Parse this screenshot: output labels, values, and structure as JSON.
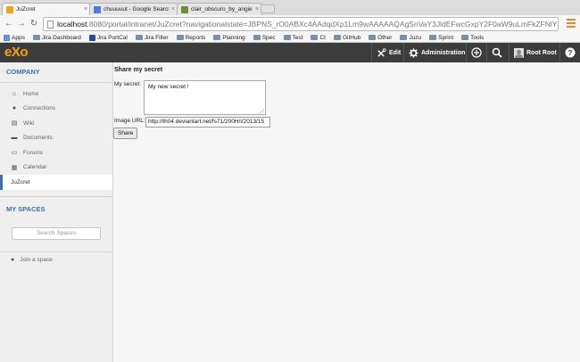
{
  "browser": {
    "tabs": [
      {
        "title": "JuZcret",
        "active": true,
        "favicon_color": "#f7a21b"
      },
      {
        "title": "chuuuuut - Google Search",
        "active": false,
        "favicon_color": "#4a7be0"
      },
      {
        "title": "clair_obscuro_by_angiecal",
        "active": false,
        "favicon_color": "#6a8f3a"
      }
    ],
    "url_host": "localhost",
    "url_rest": ":8080/portal/intranet/JuZcret?navigationalstate=JBPNS_rO0ABXc4AAdqdXp1Lm9wAAAAAQAgSnVaY3JldEFwcGxpY2F0aW9uLmFkZFNlY3JldEZvcm0AB1...",
    "bookmarks": [
      {
        "label": "Apps",
        "icon": "apps-grid-icon"
      },
      {
        "label": "Jira Dashboard",
        "icon": "folder-icon"
      },
      {
        "label": "Jira PortCal",
        "icon": "jira-icon"
      },
      {
        "label": "Jira Filter",
        "icon": "folder-icon"
      },
      {
        "label": "Reports",
        "icon": "folder-icon"
      },
      {
        "label": "Planning",
        "icon": "folder-icon"
      },
      {
        "label": "Spec",
        "icon": "folder-icon"
      },
      {
        "label": "Test",
        "icon": "folder-icon"
      },
      {
        "label": "CI",
        "icon": "folder-icon"
      },
      {
        "label": "GitHub",
        "icon": "folder-icon"
      },
      {
        "label": "Other",
        "icon": "folder-icon"
      },
      {
        "label": "Juzu",
        "icon": "folder-icon"
      },
      {
        "label": "Sprint",
        "icon": "folder-icon"
      },
      {
        "label": "Tools",
        "icon": "folder-icon"
      }
    ]
  },
  "topbar": {
    "logo": "eXo",
    "edit_label": "Edit",
    "admin_label": "Administration",
    "user_name": "Root Root",
    "accent_color": "#f7a21b"
  },
  "sidebar": {
    "company_title": "COMPANY",
    "items": [
      {
        "label": "Home",
        "icon": "home-icon",
        "active": false
      },
      {
        "label": "Connections",
        "icon": "user-icon",
        "active": false
      },
      {
        "label": "Wiki",
        "icon": "wiki-icon",
        "active": false
      },
      {
        "label": "Documents",
        "icon": "folder-icon",
        "active": false
      },
      {
        "label": "Forums",
        "icon": "forum-icon",
        "active": false
      },
      {
        "label": "Calendar",
        "icon": "calendar-icon",
        "active": false
      },
      {
        "label": "JuZcret",
        "icon": "app-icon",
        "active": true
      }
    ],
    "spaces_title": "MY SPACES",
    "search_placeholder": "Search Spaces",
    "join_label": "Join a space"
  },
  "form": {
    "title": "Share my secret",
    "secret_label": "My secret:",
    "secret_value": "My new secret !",
    "image_label": "Image URL:",
    "image_value": "http://th04.deviantart.net/fs71/200H/i/2013/15",
    "share_label": "Share"
  }
}
